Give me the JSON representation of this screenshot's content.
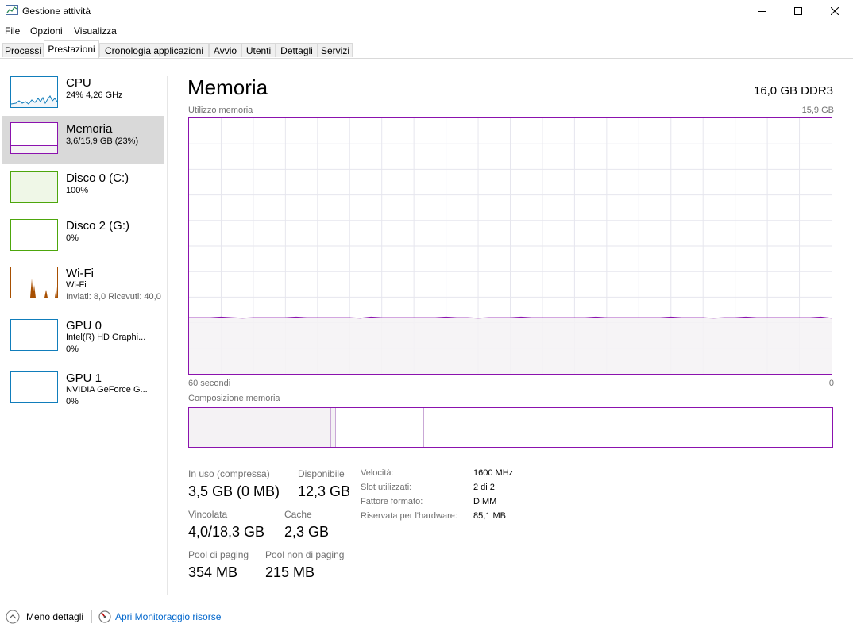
{
  "window": {
    "title": "Gestione attività"
  },
  "menu": [
    "File",
    "Opzioni",
    "Visualizza"
  ],
  "tabs": [
    "Processi",
    "Prestazioni",
    "Cronologia applicazioni",
    "Avvio",
    "Utenti",
    "Dettagli",
    "Servizi"
  ],
  "active_tab": "Prestazioni",
  "sidebar": [
    {
      "title": "CPU",
      "line1": "24%  4,26 GHz",
      "line2": "",
      "color": "#117dbb",
      "fill": "#f1f6fa"
    },
    {
      "title": "Memoria",
      "line1": "3,6/15,9 GB (23%)",
      "line2": "",
      "color": "#8b12ae",
      "fill": "#f4f2f4"
    },
    {
      "title": "Disco 0 (C:)",
      "line1": "100%",
      "line2": "",
      "color": "#4da60c",
      "fill": "#eff7e7"
    },
    {
      "title": "Disco 2 (G:)",
      "line1": "0%",
      "line2": "",
      "color": "#4da60c",
      "fill": "#ffffff"
    },
    {
      "title": "Wi-Fi",
      "line1": "Wi-Fi",
      "line2": "Inviati: 8,0  Ricevuti: 40,0",
      "color": "#a74f01",
      "fill": "#fcf3eb"
    },
    {
      "title": "GPU 0",
      "line1": "Intel(R) HD Graphi...",
      "line2": "0%",
      "color": "#117dbb",
      "fill": "#ffffff"
    },
    {
      "title": "GPU 1",
      "line1": "NVIDIA GeForce G...",
      "line2": "0%",
      "color": "#117dbb",
      "fill": "#ffffff"
    }
  ],
  "main": {
    "title": "Memoria",
    "spec": "16,0 GB DDR3",
    "chart_label": "Utilizzo memoria",
    "chart_max": "15,9 GB",
    "chart_time": "60 secondi",
    "chart_min": "0",
    "composition_label": "Composizione memoria"
  },
  "stats": {
    "in_use_label": "In uso (compressa)",
    "in_use_value": "3,5 GB (0 MB)",
    "available_label": "Disponibile",
    "available_value": "12,3 GB",
    "committed_label": "Vincolata",
    "committed_value": "4,0/18,3 GB",
    "cached_label": "Cache",
    "cached_value": "2,3 GB",
    "paged_label": "Pool di paging",
    "paged_value": "354 MB",
    "nonpaged_label": "Pool non di paging",
    "nonpaged_value": "215 MB"
  },
  "specs": [
    {
      "label": "Velocità:",
      "value": "1600 MHz"
    },
    {
      "label": "Slot utilizzati:",
      "value": "2 di 2"
    },
    {
      "label": "Fattore formato:",
      "value": "DIMM"
    },
    {
      "label": "Riservata per l'hardware:",
      "value": "85,1 MB"
    }
  ],
  "footer": {
    "less_details": "Meno dettagli",
    "resource_monitor": "Apri Monitoraggio risorse"
  },
  "colors": {
    "memory": "#8b12ae",
    "memory_fill": "#f4f2f4",
    "link": "#0066cc",
    "grid": "#e6e6ee"
  },
  "usage_fraction": 0.22
}
